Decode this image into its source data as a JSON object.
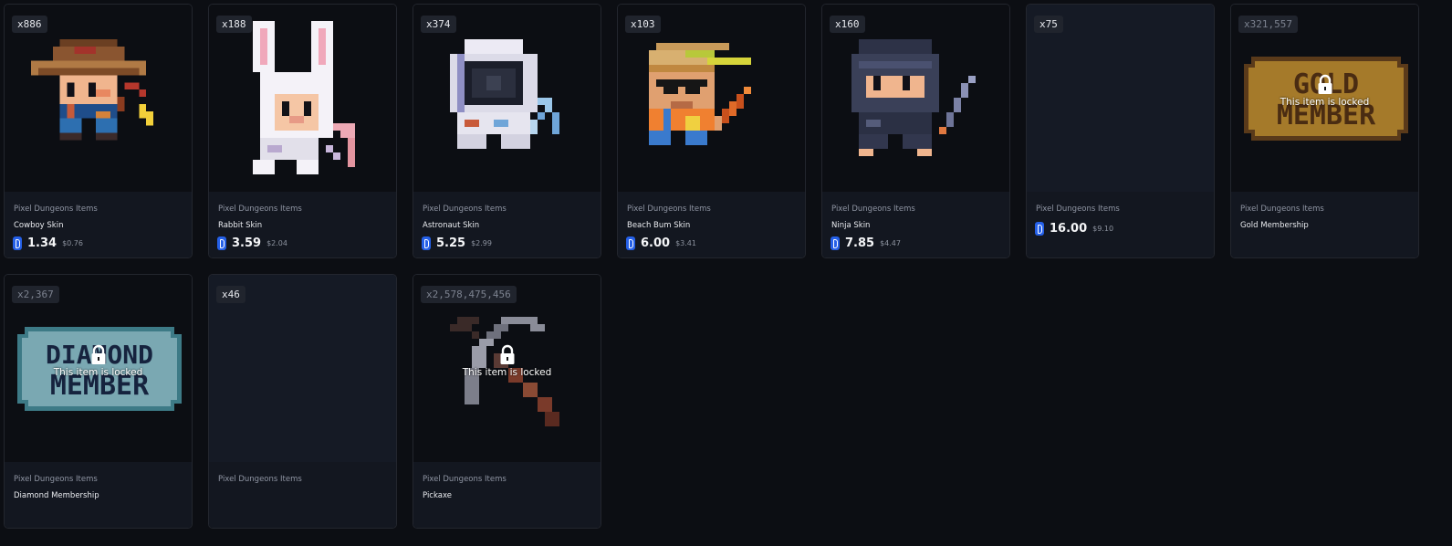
{
  "colors": {
    "page_bg": "#0c0e13",
    "card_border": "#23262e",
    "info_bg": "#131720",
    "coin": "#2560e8",
    "empty_art_bg": "#151a25"
  },
  "lock_text": "This item is locked",
  "items": [
    {
      "qty": "x886",
      "collection": "Pixel Dungeons Items",
      "name": "Cowboy Skin",
      "price": "1.34",
      "usd": "$0.76",
      "icon": "cowboy-sprite"
    },
    {
      "qty": "x188",
      "collection": "Pixel Dungeons Items",
      "name": "Rabbit Skin",
      "price": "3.59",
      "usd": "$2.04",
      "icon": "rabbit-sprite"
    },
    {
      "qty": "x374",
      "collection": "Pixel Dungeons Items",
      "name": "Astronaut Skin",
      "price": "5.25",
      "usd": "$2.99",
      "icon": "astronaut-sprite"
    },
    {
      "qty": "x103",
      "collection": "Pixel Dungeons Items",
      "name": "Beach Bum Skin",
      "price": "6.00",
      "usd": "$3.41",
      "icon": "beach-bum-sprite"
    },
    {
      "qty": "x160",
      "collection": "Pixel Dungeons Items",
      "name": "Ninja Skin",
      "price": "7.85",
      "usd": "$4.47",
      "icon": "ninja-sprite"
    },
    {
      "qty": "x75",
      "collection": "Pixel Dungeons Items",
      "name": "",
      "price": "16.00",
      "usd": "$9.10",
      "icon": ""
    },
    {
      "qty": "x321,557",
      "collection": "Pixel Dungeons Items",
      "name": "Gold Membership",
      "icon": "gold-member-sign",
      "sign_text": [
        "GOLD",
        "MEMBER"
      ]
    },
    {
      "qty": "x2,367",
      "collection": "Pixel Dungeons Items",
      "name": "Diamond Membership",
      "icon": "diamond-member-sign",
      "sign_text": [
        "DIAMOND",
        "MEMBER"
      ]
    },
    {
      "qty": "x46",
      "collection": "Pixel Dungeons Items",
      "name": "",
      "icon": ""
    },
    {
      "qty": "x2,578,475,456",
      "collection": "Pixel Dungeons Items",
      "name": "Pickaxe",
      "icon": "pickaxe-sprite"
    }
  ]
}
